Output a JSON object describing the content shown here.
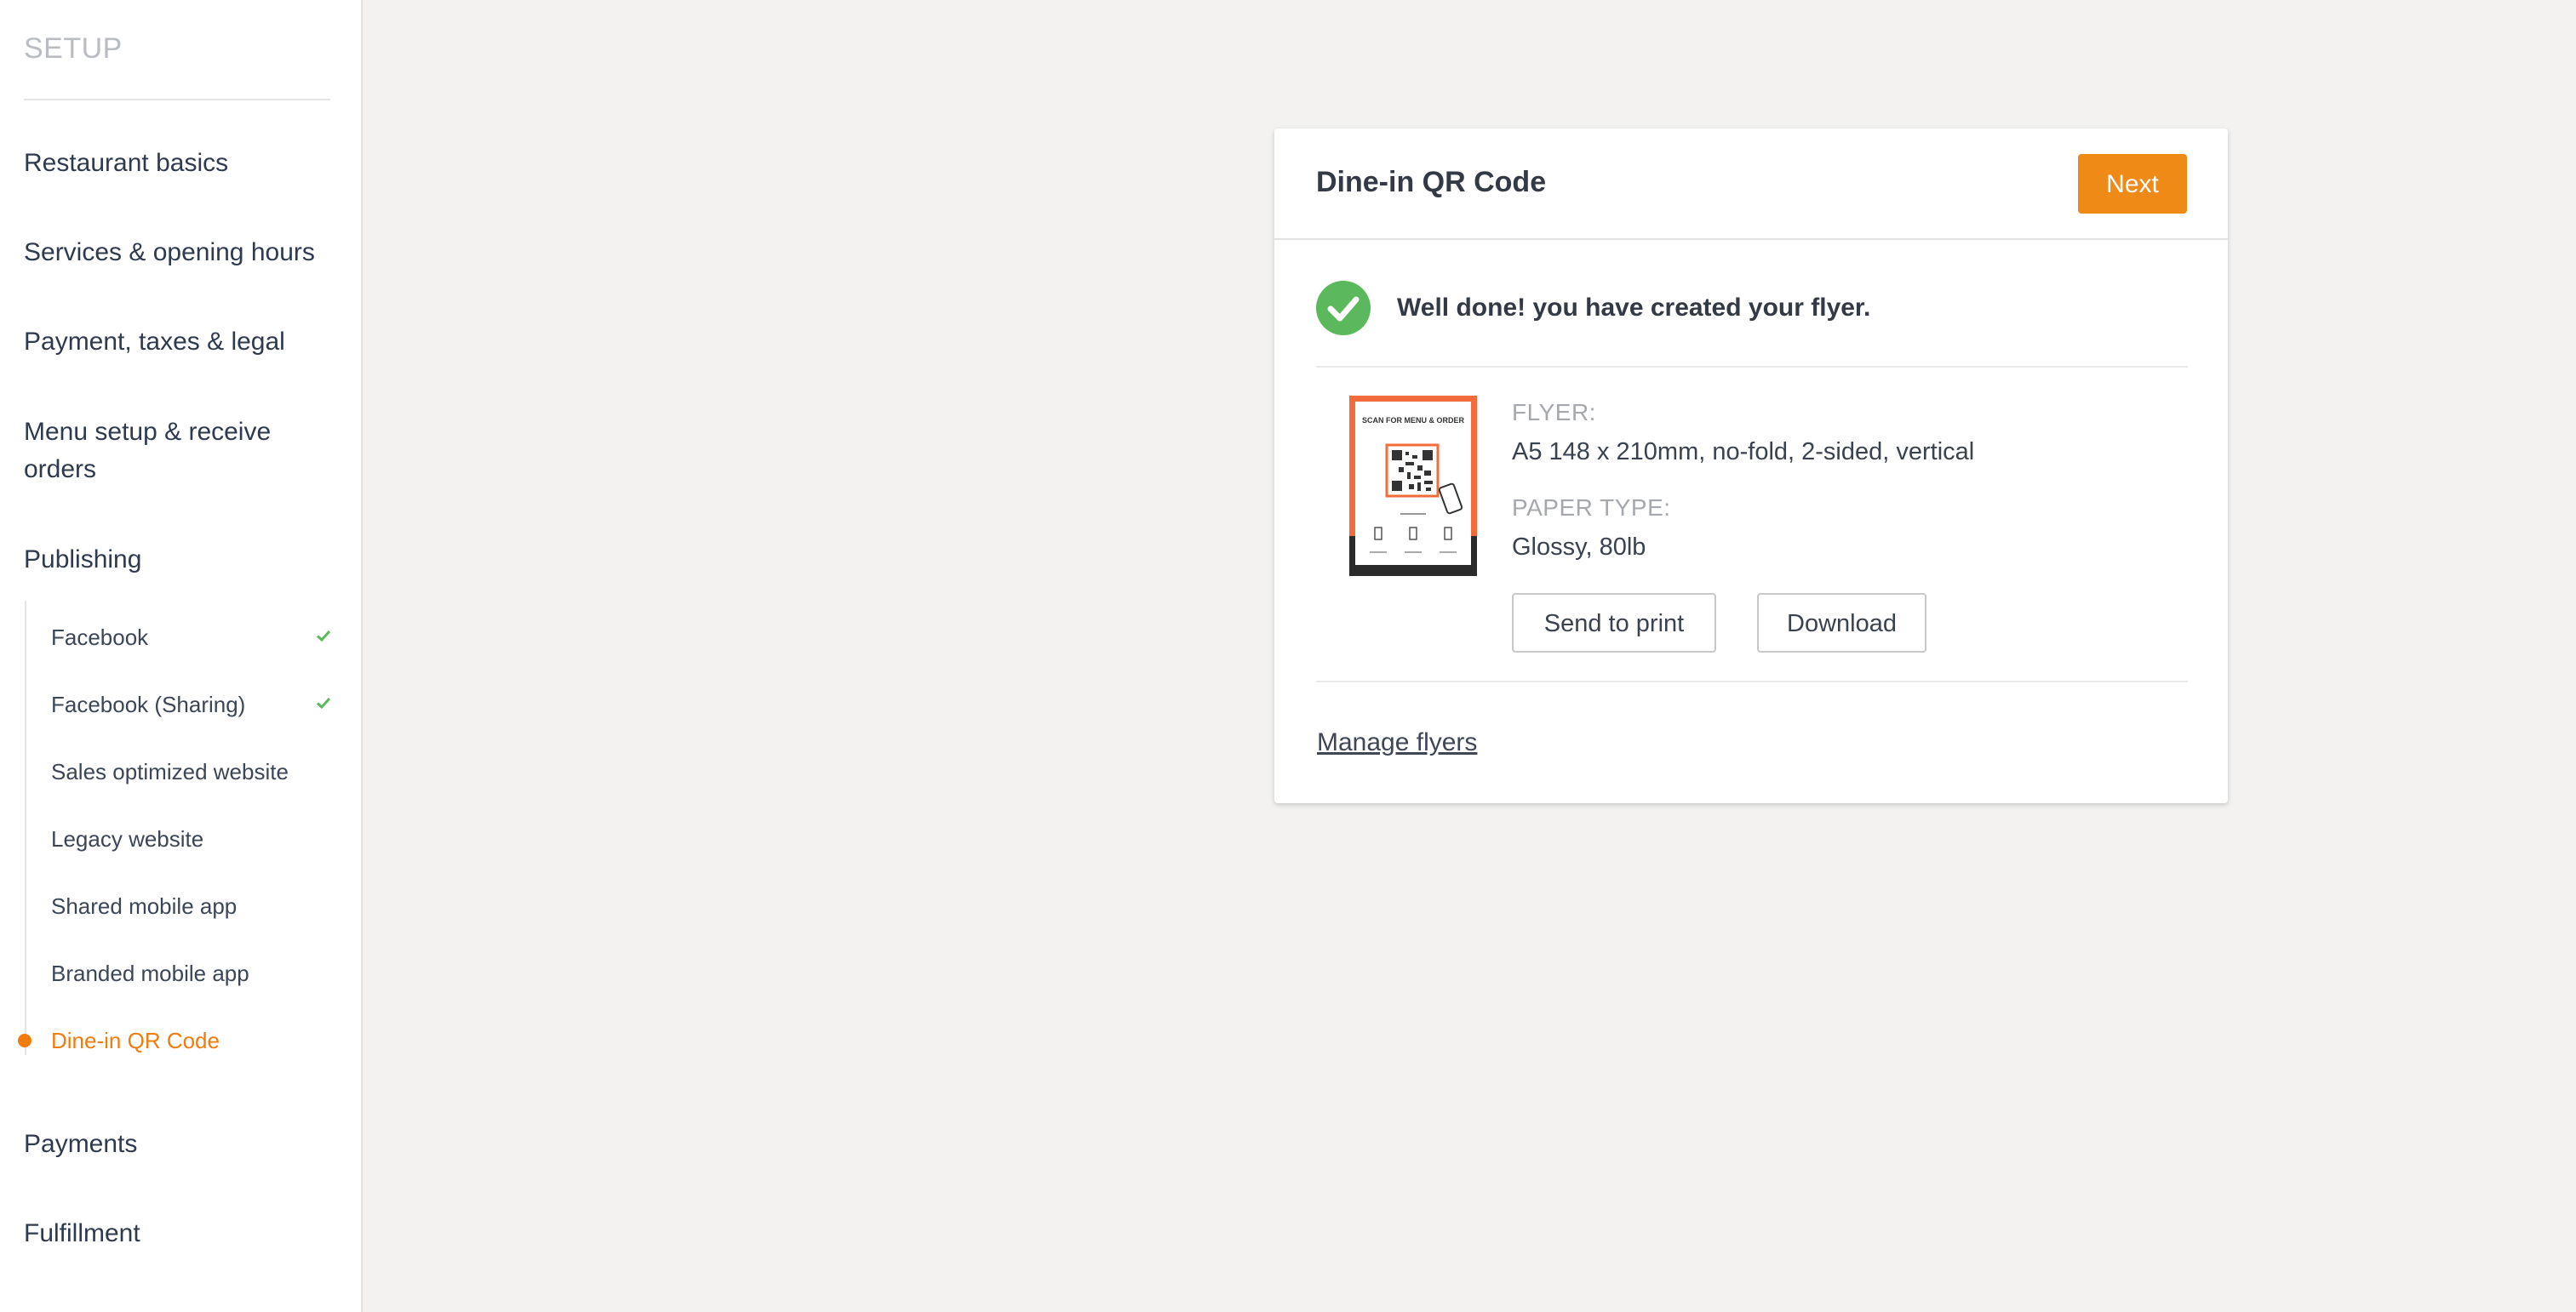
{
  "sidebar": {
    "title": "SETUP",
    "items": [
      {
        "label": "Restaurant basics"
      },
      {
        "label": "Services & opening hours"
      },
      {
        "label": "Payment, taxes & legal"
      },
      {
        "label": "Menu setup & receive orders"
      },
      {
        "label": "Publishing"
      },
      {
        "label": "Payments"
      },
      {
        "label": "Fulfillment"
      }
    ],
    "publishing_subitems": [
      {
        "label": "Facebook",
        "completed": true
      },
      {
        "label": "Facebook (Sharing)",
        "completed": true
      },
      {
        "label": "Sales optimized website",
        "completed": false
      },
      {
        "label": "Legacy website",
        "completed": false
      },
      {
        "label": "Shared mobile app",
        "completed": false
      },
      {
        "label": "Branded mobile app",
        "completed": false
      },
      {
        "label": "Dine-in QR Code",
        "completed": false,
        "active": true
      }
    ]
  },
  "card": {
    "title": "Dine-in QR Code",
    "next_label": "Next",
    "success_message": "Well done! you have created your flyer.",
    "flyer_label": "FLYER:",
    "flyer_value": "A5 148 x 210mm, no-fold, 2-sided, vertical",
    "paper_label": "PAPER TYPE:",
    "paper_value": "Glossy, 80lb",
    "send_to_print_label": "Send to print",
    "download_label": "Download",
    "manage_flyers_label": "Manage flyers",
    "thumbnail_heading": "SCAN FOR MENU & ORDER"
  },
  "colors": {
    "accent": "#f08a16",
    "active_text": "#f07c0e",
    "success": "#5cb85c",
    "background": "#f3f2f0"
  }
}
